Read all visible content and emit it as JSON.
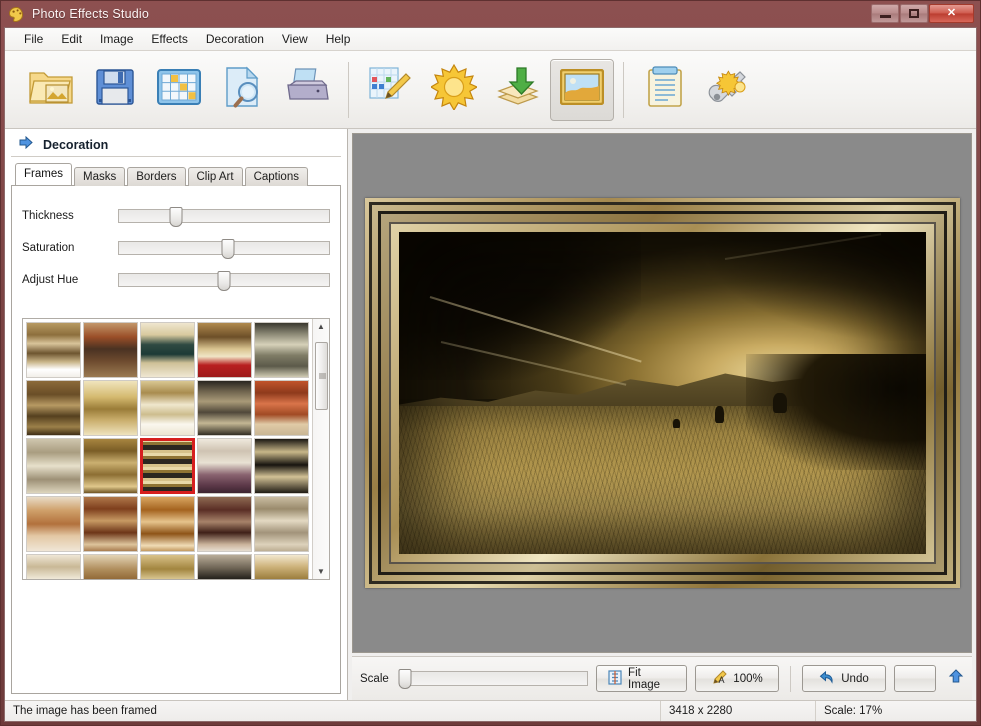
{
  "window": {
    "title": "Photo Effects Studio",
    "icon": "palette-icon",
    "controls": {
      "minimize": "minimize",
      "maximize": "maximize",
      "close": "close"
    }
  },
  "menubar": {
    "items": [
      {
        "label": "File"
      },
      {
        "label": "Edit"
      },
      {
        "label": "Image"
      },
      {
        "label": "Effects"
      },
      {
        "label": "Decoration"
      },
      {
        "label": "View"
      },
      {
        "label": "Help"
      }
    ]
  },
  "toolbar": {
    "buttons": [
      {
        "icon": "open-folder-image-icon",
        "name": "open-image-button",
        "active": false
      },
      {
        "icon": "floppy-save-icon",
        "name": "save-image-button",
        "active": false
      },
      {
        "icon": "thumbnail-grid-icon",
        "name": "browse-thumbnails-button",
        "active": false
      },
      {
        "icon": "document-magnifier-icon",
        "name": "preview-button",
        "active": false
      },
      {
        "icon": "printer-icon",
        "name": "print-button",
        "active": false
      },
      {
        "icon": "grid-pencil-icon",
        "name": "edit-pixels-button",
        "active": false
      },
      {
        "icon": "sun-icon",
        "name": "effects-button",
        "active": false
      },
      {
        "icon": "layers-download-icon",
        "name": "import-layers-button",
        "active": false
      },
      {
        "icon": "framed-picture-icon",
        "name": "decoration-button",
        "active": true
      },
      {
        "icon": "clipboard-notes-icon",
        "name": "notes-button",
        "active": false
      },
      {
        "icon": "key-sun-icon",
        "name": "license-button",
        "active": false
      }
    ]
  },
  "panel": {
    "header": {
      "title": "Decoration",
      "icon": "blue-right-arrow-icon"
    },
    "tabs": [
      {
        "label": "Frames",
        "active": true
      },
      {
        "label": "Masks",
        "active": false
      },
      {
        "label": "Borders",
        "active": false
      },
      {
        "label": "Clip Art",
        "active": false
      },
      {
        "label": "Captions",
        "active": false
      }
    ],
    "sliders": [
      {
        "label": "Thickness",
        "value": 27
      },
      {
        "label": "Saturation",
        "value": 52
      },
      {
        "label": "Adjust Hue",
        "value": 50
      }
    ],
    "frame_grid": {
      "columns": 5,
      "selected_index": 12,
      "scrollbar": {
        "position": 14,
        "up_icon": "scroll-up-arrow-icon",
        "down_icon": "scroll-down-arrow-icon"
      },
      "swatches": [
        {
          "name": "frame-ornate-gold-carved",
          "css": "linear-gradient(180deg,#b79a62 0%,#8d6f3d 22%,#d8c49a 38%,#6e5530 56%,#c9b589 72%,#ffffff 86%,#f2efe8 100%)"
        },
        {
          "name": "frame-rust-mottled",
          "css": "linear-gradient(180deg,#c2976a 0%,#9a4e28 26%,#4a3222 48%,#6d4a2e 70%,#9a7a52 100%)"
        },
        {
          "name": "frame-cream-teal-band",
          "css": "linear-gradient(180deg,#efe6cf 0%,#d8c99e 22%,#2f4a42 40%,#1d3a36 58%,#cfc197 74%,#efe7d2 100%)"
        },
        {
          "name": "frame-gold-red-stripe",
          "css": "linear-gradient(180deg,#b08a4e 0%,#6d4f28 26%,#d9c38f 48%,#f0e5c6 62%,#b82020 78%,#9d1a1a 100%)"
        },
        {
          "name": "frame-grey-scroll",
          "css": "linear-gradient(180deg,#3a382f 0%,#8a8774 20%,#d6d1b9 40%,#7f7c66 60%,#5c5a4a 80%,#cfcab2 100%)"
        },
        {
          "name": "frame-brown-bead",
          "css": "linear-gradient(180deg,#8b6a3a 0%,#6a4e27 25%,#b79a63 45%,#55401f 65%,#9c8049 85%,#3e2e16 100%)"
        },
        {
          "name": "frame-golden-gradient",
          "css": "linear-gradient(180deg,#f0e4bd 0%,#d4b96f 30%,#9a7c38 52%,#c9ad6b 72%,#efe3bc 100%)"
        },
        {
          "name": "frame-pale-gold-wash",
          "css": "linear-gradient(180deg,#d9c893 0%,#a98c4f 22%,#efe7cd 44%,#cdbd8e 62%,#faf7ee 80%,#ece5d2 100%)"
        },
        {
          "name": "frame-dark-scroll-carved",
          "css": "linear-gradient(180deg,#2a2620 0%,#6b604b 18%,#a99a78 38%,#50483a 58%,#c4b794 78%,#332e24 100%)"
        },
        {
          "name": "frame-red-ribbed",
          "css": "linear-gradient(180deg,#c1532a 0%,#8e3a1c 22%,#d9744a 42%,#a14a24 62%,#e0caa6 80%,#c9b694 100%)"
        },
        {
          "name": "frame-silver-lattice",
          "css": "linear-gradient(180deg,#cfc6ae 0%,#a99d80 25%,#e7e0cb 50%,#9d9076 75%,#ddd5bd 100%)"
        },
        {
          "name": "frame-gold-relief-scroll",
          "css": "linear-gradient(180deg,#a8853f 0%,#7a5d26 22%,#cbb071 44%,#8c6e33 66%,#e0c88c 88%,#6f5525 100%)"
        },
        {
          "name": "frame-striped-gold-black",
          "css": "repeating-linear-gradient(180deg,#e8d9a8 0 3px,#8f7434 3px 6px,#2b2720 6px 11px,#d6c28a 11px 14px)"
        },
        {
          "name": "frame-purple-shell",
          "css": "linear-gradient(180deg,#efe9dd 0%,#cfc3b2 22%,#e9e2d4 44%,#8a6470 66%,#5e3a4a 85%,#3d2430 100%)"
        },
        {
          "name": "frame-black-gold-acanthus",
          "css": "linear-gradient(180deg,#1a1712 0%,#c8b789 24%,#17140f 48%,#d2c195 70%,#201c15 100%)"
        },
        {
          "name": "frame-copper-rope",
          "css": "linear-gradient(180deg,#e8dbc6 0%,#cfa06a 25%,#b2713c 50%,#e3c8a4 72%,#f0e6d6 100%)"
        },
        {
          "name": "frame-mahogany-layered",
          "css": "linear-gradient(180deg,#b0784a 0%,#7e3f1d 22%,#c79a63 44%,#6d3518 66%,#ddc49c 88%,#a97c4f 100%)"
        },
        {
          "name": "frame-amber-wood",
          "css": "linear-gradient(180deg,#d9a661 0%,#a4631f 24%,#e6c48c 46%,#8e5418 68%,#f0dcb6 90%,#c49a60 100%)"
        },
        {
          "name": "frame-plum-wood",
          "css": "linear-gradient(180deg,#8e6a52 0%,#5a2e25 24%,#a7836a 46%,#3f2018 66%,#cbb49c 88%,#e6ddd0 100%)"
        },
        {
          "name": "frame-beige-patterned",
          "css": "linear-gradient(180deg,#cbbda2 0%,#9a8b6d 22%,#e3d9c2 44%,#a2937a 66%,#ddd2bb 88%,#bdae93 100%)"
        },
        {
          "name": "frame-ivory-greek-key",
          "css": "linear-gradient(180deg,#efe7d6 0%,#c9b896 22%,#efe8d7 44%,#b8a684 66%,#e6dcc6 88%,#cabb9b 100%)"
        },
        {
          "name": "frame-tan-speckle",
          "css": "linear-gradient(180deg,#e3d4b6 0%,#b08f5e 26%,#8a5f2c 50%,#d9c49a 74%,#efe3cb 100%)"
        },
        {
          "name": "frame-gold-mask-relief",
          "css": "linear-gradient(180deg,#d9c28a 0%,#a2853f 26%,#e9d9a9 50%,#8d7233 74%,#cbb37a 100%)"
        },
        {
          "name": "frame-granite-dark",
          "css": "linear-gradient(180deg,#b9ad99 0%,#6f6556 24%,#171511 48%,#3d372d 72%,#8f8573 100%)"
        },
        {
          "name": "frame-cream-gold-ridge",
          "css": "linear-gradient(180deg,#f2e8cf 0%,#cdb27a 22%,#9d7f3f 44%,#e2d2a6 66%,#f5edd8 88%,#d3c39a 100%)"
        }
      ]
    }
  },
  "canvas": {
    "frame_applied": true,
    "background_color": "#8a8a8a"
  },
  "bottombar": {
    "scale_label": "Scale",
    "scale_value": 3,
    "buttons": [
      {
        "label": "Fit Image",
        "icon": "fit-image-icon",
        "name": "fit-image-button"
      },
      {
        "label": "100%",
        "icon": "actual-size-icon",
        "name": "actual-size-button"
      },
      {
        "label": "Undo",
        "icon": "undo-arrow-icon",
        "name": "undo-button"
      },
      {
        "label": "",
        "icon": "",
        "name": "blank-button"
      }
    ],
    "up_icon": "blue-up-arrow-icon"
  },
  "statusbar": {
    "message": "The image has been framed",
    "dimensions": "3418 x 2280",
    "scale": "Scale: 17%"
  },
  "colors": {
    "titlebar": "#7a4343",
    "accent_red": "#d61f1f",
    "canvas_bg": "#8a8a8a",
    "panel_bg": "#ffffff"
  }
}
